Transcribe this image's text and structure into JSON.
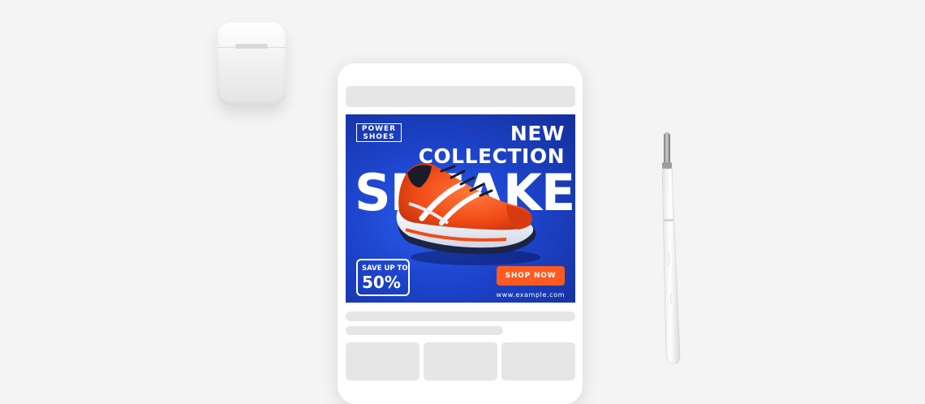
{
  "ad": {
    "brand_line1": "POWER",
    "brand_line2": "SHOES",
    "headline_line1": "NEW",
    "headline_line2": "COLLECTION",
    "headline_big": "SNEAKERS",
    "discount_line1": "SAVE UP TO",
    "discount_value": "50%",
    "cta_label": "SHOP NOW",
    "url": "www.example.com"
  },
  "colors": {
    "banner_blue": "#1d44cc",
    "cta_orange": "#ff5a1f",
    "shoe_orange": "#ff5722",
    "background": "#f4f4f4",
    "skeleton": "#e6e6e6"
  },
  "icons": [
    "sneaker-image",
    "earbuds-case",
    "pen"
  ]
}
